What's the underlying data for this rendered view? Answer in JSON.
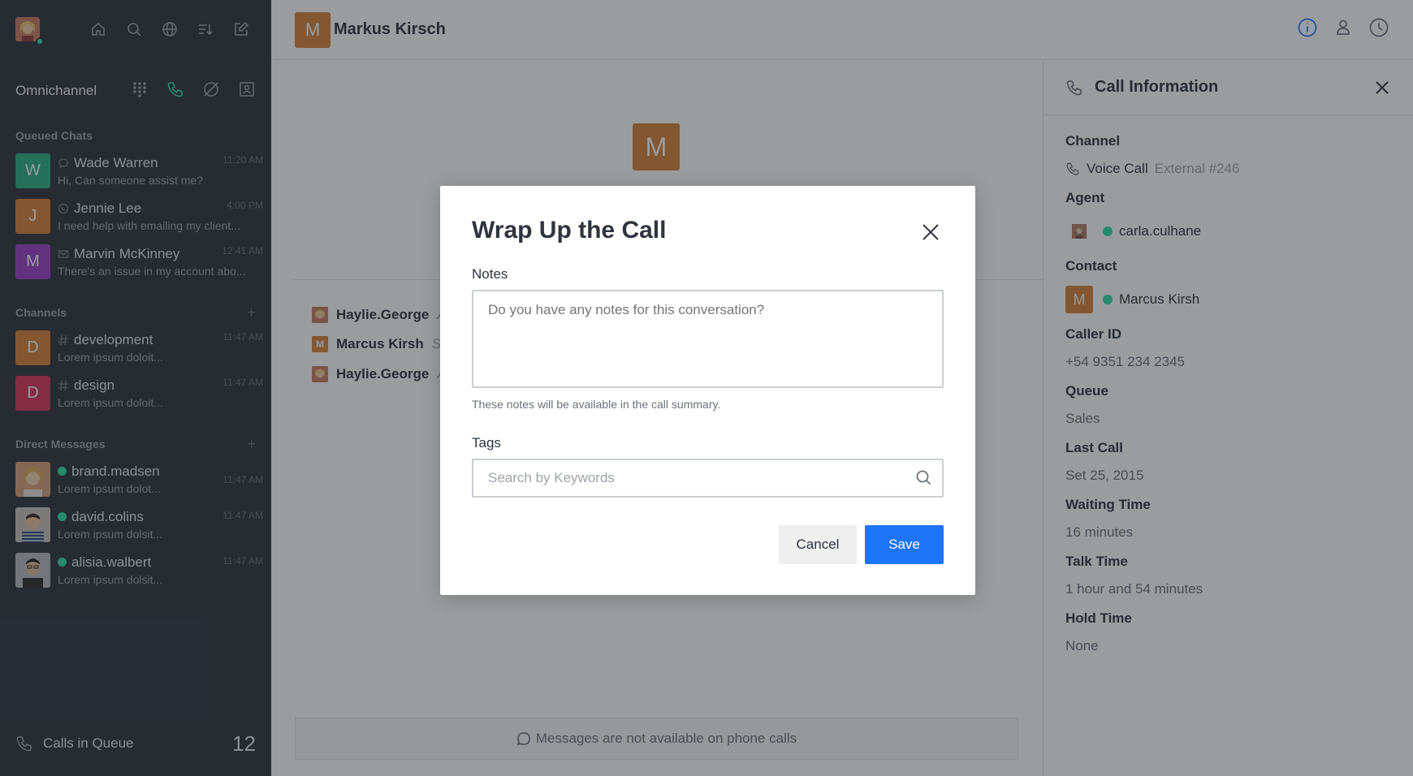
{
  "sidebar": {
    "omnichannel_title": "Omnichannel",
    "queued_title": "Queued Chats",
    "queued": [
      {
        "initial": "W",
        "name": "Wade Warren",
        "preview": "Hi, Can someone assist me?",
        "time": "11:20 AM",
        "color": "#2bb080",
        "icon": "livechat-icon"
      },
      {
        "initial": "J",
        "name": "Jennie Lee",
        "preview": "I need help with emailing my client...",
        "time": "4:00 PM",
        "color": "#d4823a",
        "icon": "whatsapp-icon"
      },
      {
        "initial": "M",
        "name": "Marvin McKinney",
        "preview": "There's an issue in my account abo...",
        "time": "12:41 AM",
        "color": "#9b3ec6",
        "icon": "email-icon"
      }
    ],
    "channels_title": "Channels",
    "channels": [
      {
        "initial": "D",
        "name": "development",
        "preview": "Lorem ipsum doloit...",
        "time": "11:47 AM",
        "color": "#d4823a"
      },
      {
        "initial": "D",
        "name": "design",
        "preview": "Lorem ipsum doloit...",
        "time": "11:47 AM",
        "color": "#d6345c"
      }
    ],
    "dm_title": "Direct Messages",
    "dms": [
      {
        "name": "brand.madsen",
        "preview": "Lorem ipsum dolot...",
        "time": "11:47 AM"
      },
      {
        "name": "david.colins",
        "preview": "Lorem ipsum dolsit...",
        "time": "11:47 AM"
      },
      {
        "name": "alisia.walbert",
        "preview": "Lorem ipsum dolsit...",
        "time": "11:47 AM"
      }
    ],
    "calls_in_queue_label": "Calls in Queue",
    "calls_in_queue_count": "12"
  },
  "header": {
    "avatar_initial": "M",
    "contact_name": "Markus Kirsch"
  },
  "room": {
    "center_initial": "M",
    "messages": [
      {
        "author": "Haylie.George",
        "rest": "A"
      },
      {
        "author": "Marcus Kirsh",
        "rest": "S",
        "initial": "M"
      },
      {
        "author": "Haylie.George",
        "rest": "A"
      }
    ],
    "composer_notice": "Messages are not available on phone calls"
  },
  "info_panel": {
    "title": "Call Information",
    "channel_label": "Channel",
    "channel_value": "Voice Call",
    "channel_extra": "External #246",
    "agent_label": "Agent",
    "agent_value": "carla.culhane",
    "contact_label": "Contact",
    "contact_initial": "M",
    "contact_value": "Marcus Kirsh",
    "caller_id_label": "Caller ID",
    "caller_id_value": "+54 9351 234 2345",
    "queue_label": "Queue",
    "queue_value": "Sales",
    "last_call_label": "Last Call",
    "last_call_value": "Set 25, 2015",
    "waiting_label": "Waiting Time",
    "waiting_value": "16 minutes",
    "talk_label": "Talk Time",
    "talk_value": "1 hour and 54 minutes",
    "hold_label": "Hold Time",
    "hold_value": "None"
  },
  "modal": {
    "title": "Wrap Up the Call",
    "notes_label": "Notes",
    "notes_placeholder": "Do you have any notes for this conversation?",
    "notes_help": "These notes will be available in the call summary.",
    "tags_label": "Tags",
    "tags_placeholder": "Search by Keywords",
    "cancel_label": "Cancel",
    "save_label": "Save"
  },
  "colors": {
    "sidebar_bg": "#2f343d",
    "accent_blue": "#1d74f5",
    "online_green": "#2de0a5",
    "avatar_orange": "#d4823a"
  }
}
